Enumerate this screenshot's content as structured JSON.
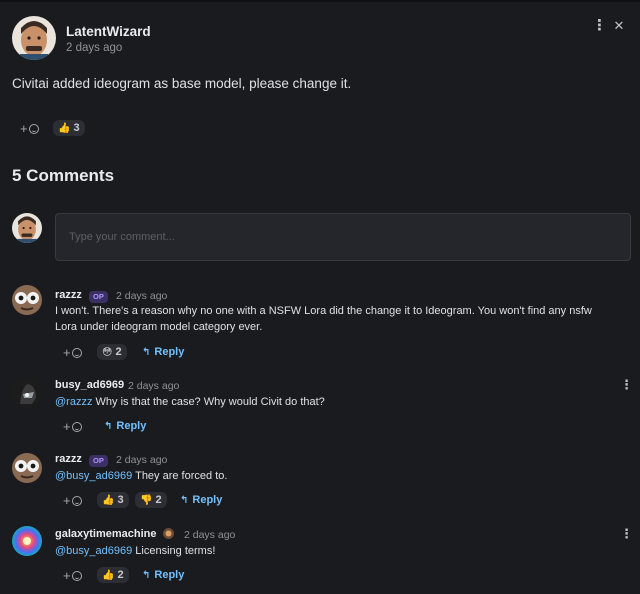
{
  "post": {
    "author": "LatentWizard",
    "time": "2 days ago",
    "body": "Civitai added ideogram as base model, please change it.",
    "reactions": [
      {
        "emoji": "👍",
        "count": "3"
      }
    ]
  },
  "icons": {
    "more": "⋮",
    "close": "✕",
    "plus": "+",
    "reply_arrow": "↰"
  },
  "comments_header": "5 Comments",
  "comment_input": {
    "placeholder": "Type your comment..."
  },
  "reply_label": "Reply",
  "op_label": "OP",
  "comments": [
    {
      "author": "razzz",
      "op": true,
      "time": "2 days ago",
      "line1": "I won't. There's a reason why no one with a NSFW Lora did the change it to Ideogram. You won't find any nsfw",
      "line2": "Lora under ideogram model category ever.",
      "reactions": [
        {
          "emoji": "😳",
          "count": "2"
        }
      ]
    },
    {
      "author": "busy_ad6969",
      "time": "2 days ago",
      "mention": "@razzz",
      "text": "Why is that the case? Why would Civit do that?"
    },
    {
      "author": "razzz",
      "op": true,
      "time": "2 days ago",
      "mention": "@busy_ad6969",
      "text": "They are forced to.",
      "reactions": [
        {
          "emoji": "👍",
          "count": "3"
        },
        {
          "emoji": "👎",
          "count": "2"
        }
      ]
    },
    {
      "author": "galaxytimemachine",
      "time": "2 days ago",
      "mention": "@busy_ad6969",
      "text": "Licensing terms!",
      "reactions": [
        {
          "emoji": "👍",
          "count": "2"
        }
      ]
    }
  ],
  "colors": {
    "background": "#1a1b1e",
    "accent_link": "#74c0fc",
    "pill_bg": "#2c2e33",
    "op_badge_bg": "#3b2f63",
    "op_badge_text": "#b197fc"
  }
}
